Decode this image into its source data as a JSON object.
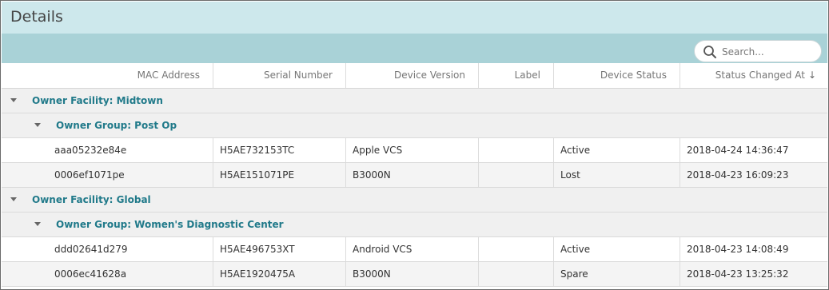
{
  "panel": {
    "title": "Details"
  },
  "search": {
    "placeholder": "Search..."
  },
  "columns": [
    {
      "label": "MAC Address"
    },
    {
      "label": "Serial Number"
    },
    {
      "label": "Device Version"
    },
    {
      "label": "Label"
    },
    {
      "label": "Device Status"
    },
    {
      "label": "Status Changed At",
      "sort": "descending"
    }
  ],
  "groups": [
    {
      "facility": "Owner Facility: Midtown",
      "group": "Owner Group: Post Op",
      "rows": [
        {
          "mac": "aaa05232e84e",
          "serial": "H5AE732153TC",
          "version": "Apple VCS",
          "label": "",
          "status": "Active",
          "changed": "2018-04-24 14:36:47"
        },
        {
          "mac": "0006ef1071pe",
          "serial": "H5AE151071PE",
          "version": "B3000N",
          "label": "",
          "status": "Lost",
          "changed": "2018-04-23 16:09:23"
        }
      ]
    },
    {
      "facility": "Owner Facility: Global",
      "group": "Owner Group: Women's Diagnostic Center",
      "rows": [
        {
          "mac": "ddd02641d279",
          "serial": "H5AE496753XT",
          "version": "Android VCS",
          "label": "",
          "status": "Active",
          "changed": "2018-04-23 14:08:49"
        },
        {
          "mac": "0006ec41628a",
          "serial": "H5AE1920475A",
          "version": "B3000N",
          "label": "",
          "status": "Spare",
          "changed": "2018-04-23 13:25:32"
        }
      ]
    }
  ]
}
